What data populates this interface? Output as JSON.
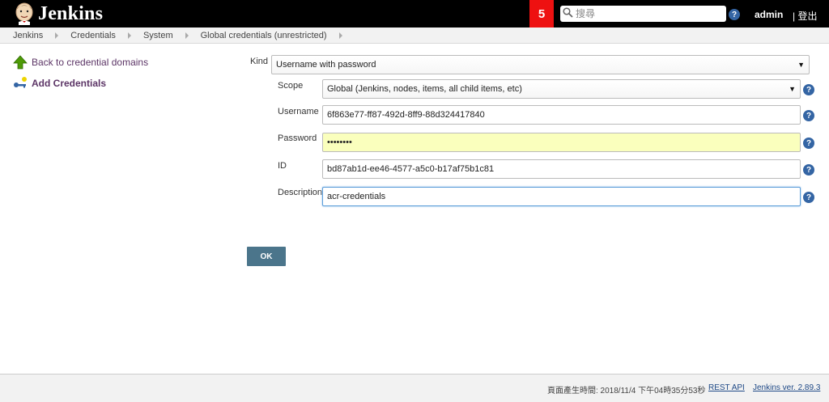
{
  "header": {
    "title": "Jenkins",
    "notification_count": "5",
    "search_placeholder": "搜尋",
    "help_label": "?",
    "user": "admin",
    "logout": "| 登出"
  },
  "breadcrumbs": [
    "Jenkins",
    "Credentials",
    "System",
    "Global credentials (unrestricted)"
  ],
  "sidebar": {
    "items": [
      {
        "label": "Back to credential domains",
        "icon": "up-arrow-icon"
      },
      {
        "label": "Add Credentials",
        "icon": "key-icon"
      }
    ]
  },
  "form": {
    "kind_label": "Kind",
    "kind_value": "Username with password",
    "scope_label": "Scope",
    "scope_value": "Global (Jenkins, nodes, items, all child items, etc)",
    "username_label": "Username",
    "username_value": "6f863e77-ff87-492d-8ff9-88d324417840",
    "password_label": "Password",
    "password_value": "••••••••",
    "id_label": "ID",
    "id_value": "bd87ab1d-ee46-4577-a5c0-b17af75b1c81",
    "description_label": "Description",
    "description_value": "acr-credentials",
    "ok_label": "OK"
  },
  "footer": {
    "generated": "頁面產生時間: 2018/11/4 下午04時35分53秒",
    "rest_api": "REST API",
    "version": "Jenkins ver. 2.89.3"
  },
  "colors": {
    "header_bg": "#000000",
    "badge_red": "#ee1111",
    "ok_button": "#4b758b",
    "password_bg": "#faffbd",
    "help_icon": "#3465a4"
  }
}
